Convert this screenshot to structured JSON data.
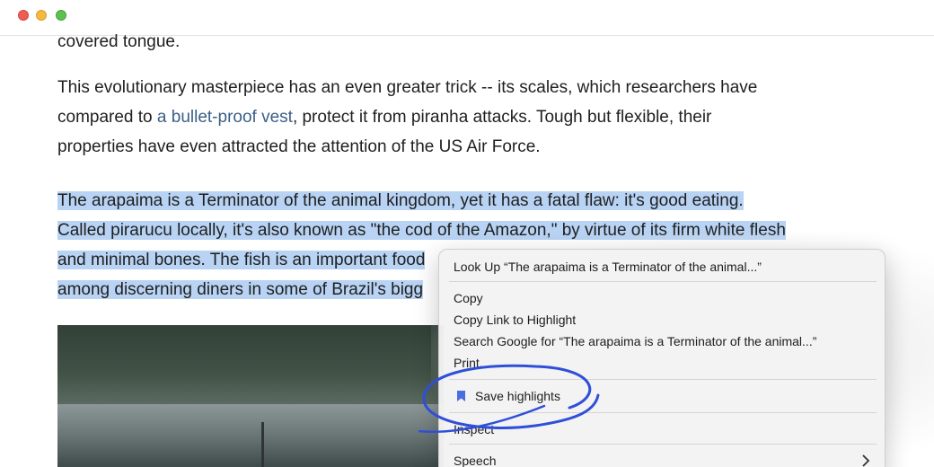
{
  "window": {
    "controls": [
      "close",
      "minimize",
      "zoom"
    ]
  },
  "article": {
    "tail_text": "covered tongue.",
    "p2": {
      "line1": "This evolutionary masterpiece has an even greater trick -- its scales, which researchers have",
      "line2_before": "compared to ",
      "line2_link": "a bullet-proof vest",
      "line2_after": ", protect it from piranha attacks. Tough but flexible, their",
      "line3": "properties have even attracted the attention of the US Air Force."
    },
    "p3": {
      "line1": "The arapaima is a Terminator of the animal kingdom, yet it has a fatal flaw: it's good eating.",
      "line2": "Called pirarucu locally, it's also known as \"the cod of the Amazon,\" by virtue of its firm white flesh",
      "line3": "and minimal bones. The fish is an important food",
      "line4": "among discerning diners in some of Brazil's bigg"
    }
  },
  "context_menu": {
    "look_up": "Look Up “The arapaima is a Terminator of the animal...”",
    "copy": "Copy",
    "copy_link": "Copy Link to Highlight",
    "search_google": "Search Google for “The arapaima is a Terminator of the animal...”",
    "print": "Print...",
    "save_highlights": "Save highlights",
    "inspect": "Inspect",
    "speech": "Speech"
  },
  "colors": {
    "highlight": "#b8d3f3",
    "link": "#3b5f86",
    "annotation_circle": "#2f4fd8",
    "bookmark_icon": "#4a6ee0"
  }
}
